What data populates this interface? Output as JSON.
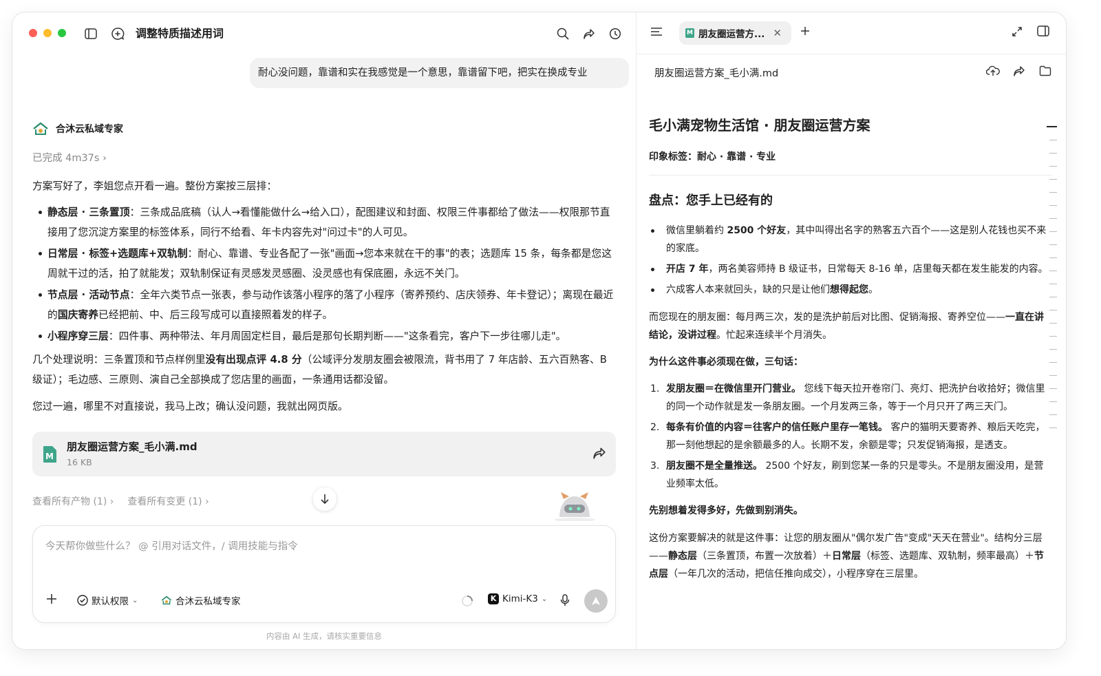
{
  "window": {
    "title": "调整特质描述用词",
    "traffic_lights": [
      "#ff5f57",
      "#febc2e",
      "#28c840"
    ]
  },
  "conversation": {
    "user_message": "耐心没问题，靠谱和实在我感觉是一个意思，靠谱留下吧，把实在换成专业",
    "bot_name": "合沐云私域专家",
    "status": "已完成 4m37s ›",
    "intro": "方案写好了，李姐您点开看一遍。整份方案按三层排：",
    "bullets": [
      {
        "bold": "静态层 · 三条置顶",
        "text": "：三条成品底稿（认人→看懂能做什么→给入口），配图建议和封面、权限三件事都给了做法——权限那节直接用了您沉淀方案里的标签体系，同行不给看、年卡内容先对\"问过卡\"的人可见。"
      },
      {
        "bold": "日常层 · 标签+选题库+双轨制",
        "text": "：耐心、靠谱、专业各配了一张\"画面→您本来就在干的事\"的表；选题库 15 条，每条都是您这周就干过的活，拍了就能发；双轨制保证有灵感发灵感圈、没灵感也有保底圈，永远不关门。"
      },
      {
        "bold": "节点层 · 活动节点",
        "text_before": "：全年六类节点一张表，参与动作该落小程序的落了小程序（寄养预约、店庆领券、年卡登记）；离现在最近的",
        "bold2": "国庆寄养",
        "text_after": "已经把前、中、后三段写成可以直接照着发的样子。"
      },
      {
        "bold": "小程序穿三层",
        "text": "：四件事、两种带法、年月周固定栏目，最后是那句长期判断——\"这条看完，客户下一步往哪儿走\"。"
      }
    ],
    "note_before": "几个处理说明：三条置顶和节点样例里",
    "note_bold": "没有出现点评 4.8 分",
    "note_after": "（公域评分发朋友圈会被限流，背书用了 7 年店龄、五六百熟客、B 级证）；毛边感、三原则、演自己全部换成了您店里的画面，一条通用话都没留。",
    "closing": "您过一遍，哪里不对直接说，我马上改；确认没问题，我就出网页版。",
    "file": {
      "name": "朋友圈运营方案_毛小满.md",
      "size": "16 KB",
      "icon_letter": "M"
    },
    "links": [
      "查看所有产物 (1) ›",
      "查看所有变更 (1) ›"
    ]
  },
  "composer": {
    "placeholder": "今天帮你做些什么？ @ 引用对话文件，/ 调用技能与指令",
    "permission": "默认权限",
    "agent": "合沐云私域专家",
    "model": "Kimi-K3",
    "disclaimer": "内容由 AI 生成，请核实重要信息"
  },
  "doc_panel": {
    "tab_label": "朋友圈运营方...",
    "file_name": "朋友圈运营方案_毛小满.md",
    "title": "毛小满宠物生活馆 · 朋友圈运营方案",
    "tag_line": "印象标签：耐心 · 靠谱 · 专业",
    "section1": "盘点：您手上已经有的",
    "items": [
      {
        "pre": "微信里躺着约 ",
        "bold": "2500 个好友",
        "post": "，其中叫得出名字的熟客五六百个——这是别人花钱也买不来的家底。"
      },
      {
        "pre": "",
        "bold": "开店 7 年",
        "post": "，两名美容师持 B 级证书，日常每天 8-16 单，店里每天都在发生能发的内容。"
      },
      {
        "pre": "六成客人本来就回头，缺的只是让他们",
        "bold": "想得起您",
        "post": "。"
      }
    ],
    "para1_pre": "而您现在的朋友圈：每月两三次，发的是洗护前后对比图、促销海报、寄养空位——",
    "para1_bold": "一直在讲结论，没讲过程",
    "para1_post": "。忙起来连续半个月消失。",
    "why_title": "为什么这件事必须现在做，三句话：",
    "reasons": [
      {
        "num": "1.",
        "bold": "发朋友圈＝在微信里开门营业。",
        "text": " 您线下每天拉开卷帘门、亮灯、把洗护台收拾好；微信里的同一个动作就是发一条朋友圈。一个月发两三条，等于一个月只开了两三天门。"
      },
      {
        "num": "2.",
        "bold": "每条有价值的内容＝往客户的信任账户里存一笔钱。",
        "text": " 客户的猫明天要寄养、粮后天吃完，那一刻他想起的是余额最多的人。长期不发，余额是零；只发促销海报，是透支。"
      },
      {
        "num": "3.",
        "bold": "朋友圈不是全量推送。",
        "text": " 2500 个好友，刷到您某一条的只是零头。不是朋友圈没用，是营业频率太低。"
      }
    ],
    "sub_title": "先别想着发得多好，先做到别消失。",
    "final_pre": "这份方案要解决的就是这件事：让您的朋友圈从\"偶尔发广告\"变成\"天天在营业\"。结构分三层——",
    "final_b1": "静态层",
    "final_t1": "（三条置顶，布置一次放着）＋",
    "final_b2": "日常层",
    "final_t2": "（标签、选题库、双轨制，频率最高）＋",
    "final_b3": "节点层",
    "final_t3": "（一年几次的活动，把信任推向成交），小程序穿在三层里。"
  }
}
